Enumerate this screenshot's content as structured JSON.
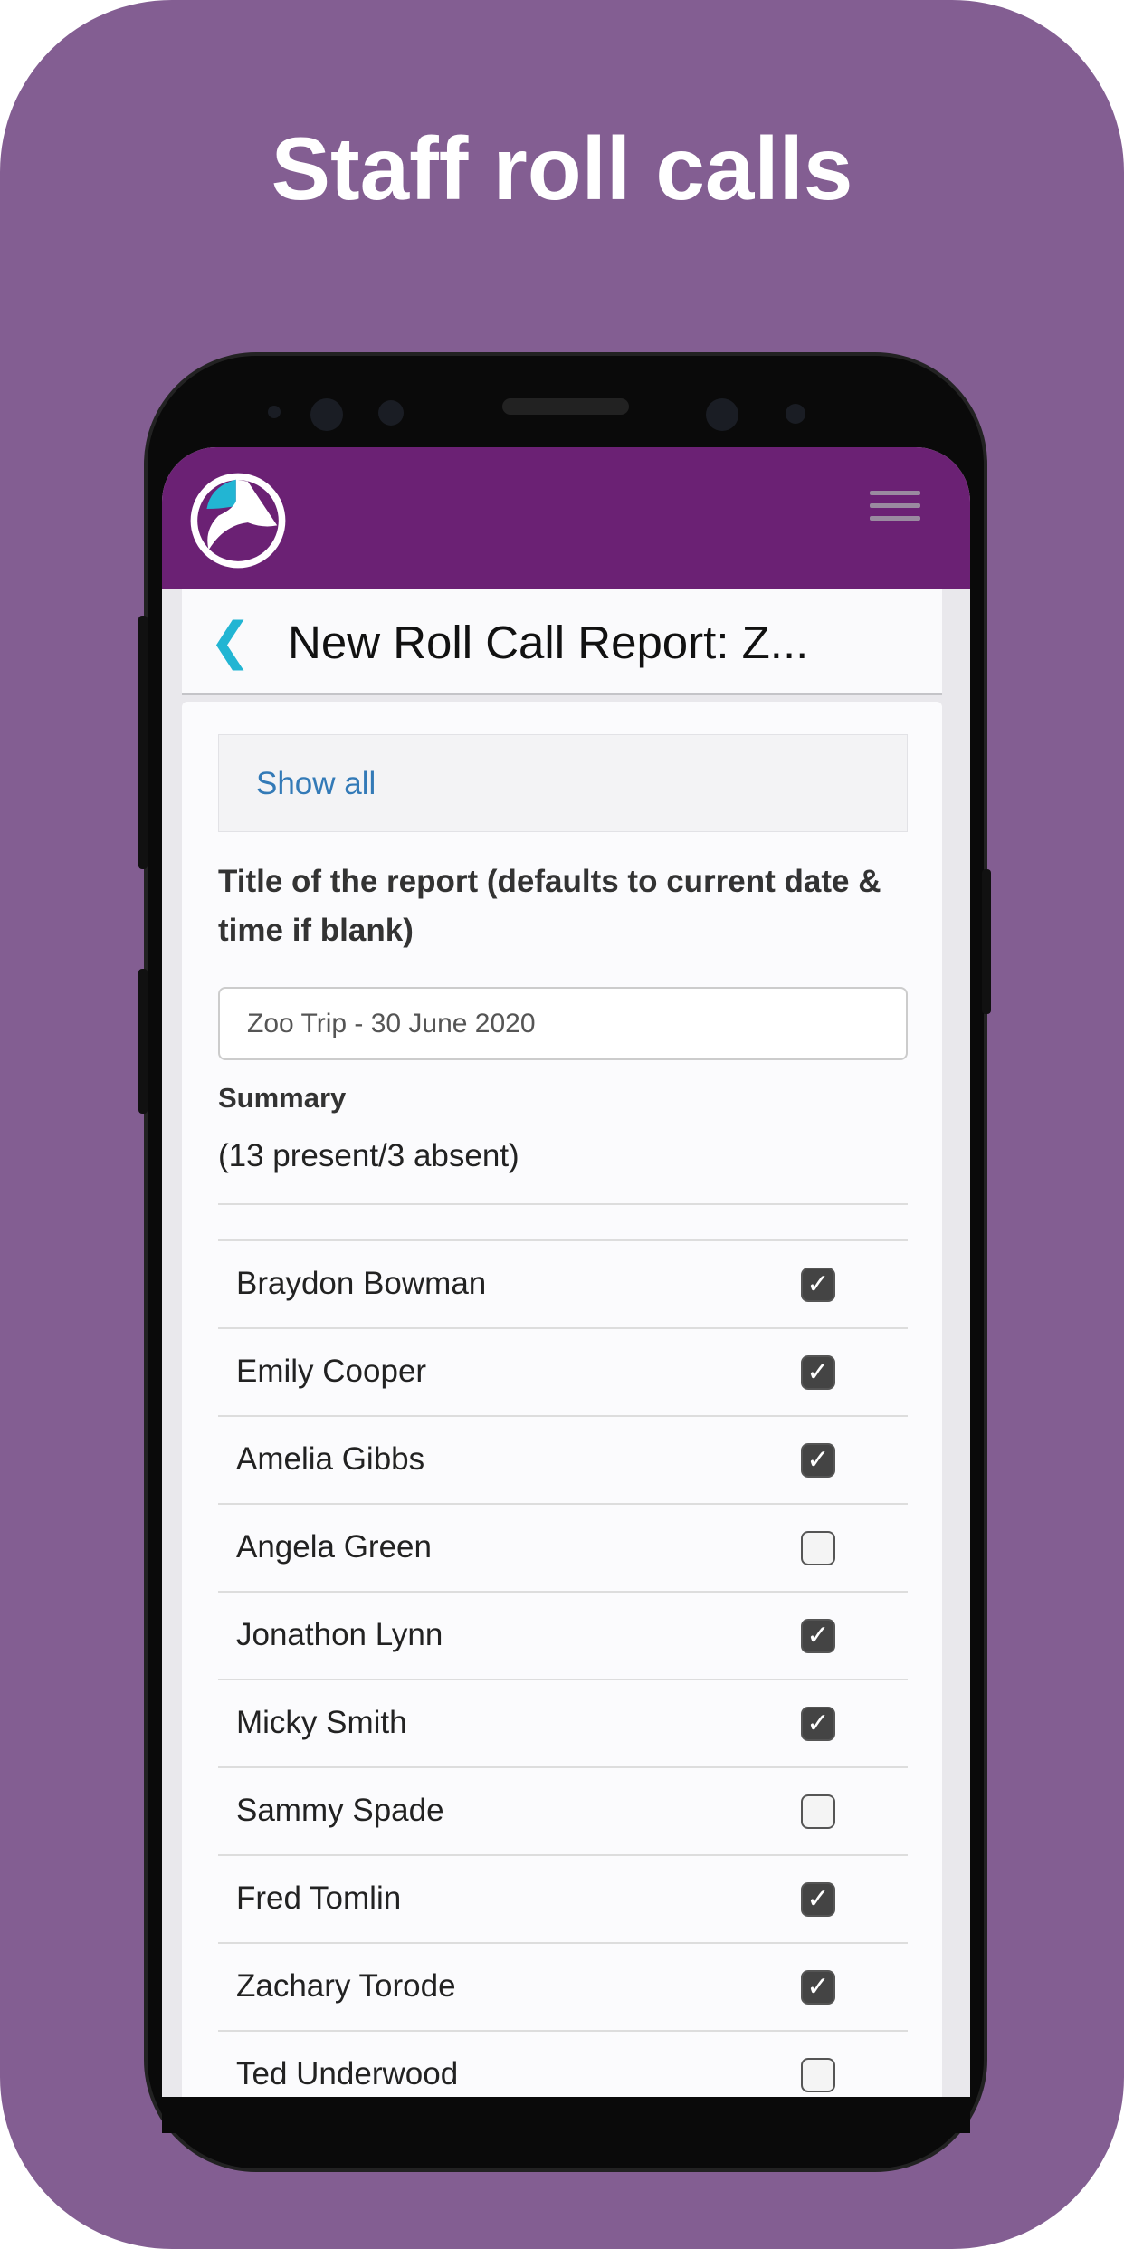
{
  "headline": "Staff roll calls",
  "colors": {
    "background": "#835e92",
    "app_bar": "#6b2174",
    "accent": "#22b5d3",
    "link": "#337ab7"
  },
  "header": {
    "title": "New Roll Call Report: Z...",
    "back_icon": "chevron-left-icon",
    "menu_icon": "hamburger-icon"
  },
  "show_all": "Show all",
  "form": {
    "title_label": "Title of the report (defaults to current date & time if blank)",
    "title_value": "Zoo Trip - 30 June 2020",
    "summary_label": "Summary",
    "summary_value": "(13 present/3 absent)"
  },
  "students": [
    {
      "name": "Braydon Bowman",
      "present": true
    },
    {
      "name": "Emily Cooper",
      "present": true
    },
    {
      "name": "Amelia Gibbs",
      "present": true
    },
    {
      "name": "Angela Green",
      "present": false
    },
    {
      "name": "Jonathon Lynn",
      "present": true
    },
    {
      "name": "Micky Smith",
      "present": true
    },
    {
      "name": "Sammy Spade",
      "present": false
    },
    {
      "name": "Fred Tomlin",
      "present": true
    },
    {
      "name": "Zachary Torode",
      "present": true
    },
    {
      "name": "Ted Underwood",
      "present": false
    }
  ]
}
